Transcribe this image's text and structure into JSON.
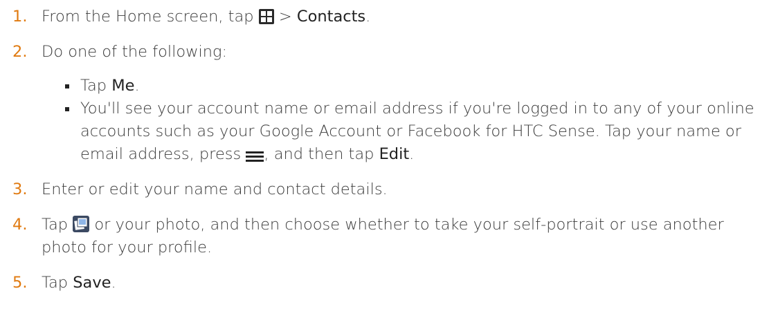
{
  "steps": [
    {
      "number": "1.",
      "text_before": "From the Home screen, tap",
      "icon": "all-apps-icon",
      "separator": ">",
      "target": "Contacts",
      "end": "."
    },
    {
      "number": "2.",
      "text": "Do one of the following:",
      "sub_items": [
        {
          "prefix": "Tap",
          "target": "Me",
          "end": "."
        },
        {
          "text_before": "You'll see your account name or email address if you're logged in to any of your online accounts such as your Google Account or Facebook for HTC Sense. Tap your name or email address, press",
          "icon": "menu-icon",
          "text_after": ", and then tap",
          "target": "Edit",
          "end": "."
        }
      ]
    },
    {
      "number": "3.",
      "text": "Enter or edit your name and contact details."
    },
    {
      "number": "4.",
      "prefix": "Tap",
      "icon": "photo-icon",
      "text": "or your photo, and then choose whether to take your self-portrait or use another photo for your profile."
    },
    {
      "number": "5.",
      "prefix": "Tap",
      "target": "Save",
      "end": "."
    }
  ],
  "colors": {
    "number": "#e07a10",
    "body_text": "#3a3a3a",
    "emphasis": "#222222"
  }
}
